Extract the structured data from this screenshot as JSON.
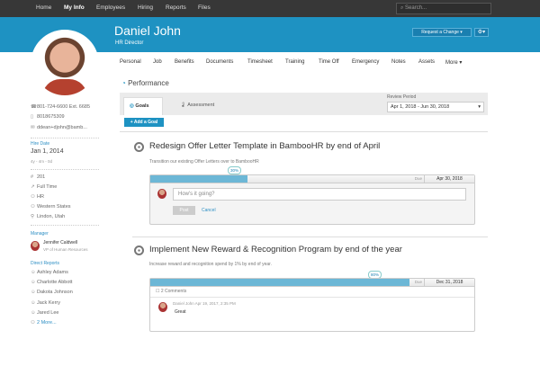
{
  "nav": {
    "items": [
      "Home",
      "My Info",
      "Employees",
      "Hiring",
      "Reports",
      "Files"
    ],
    "search_placeholder": "Search..."
  },
  "header": {
    "name": "Daniel John",
    "title": "HR Director",
    "request_change": "Request a Change ▾",
    "gear": "⚙▾"
  },
  "tabs": [
    "Personal",
    "Job",
    "Benefits",
    "Documents",
    "Timesheet",
    "Training",
    "Time Off",
    "Emergency",
    "Notes",
    "Assets",
    "More ▾"
  ],
  "sidebar": {
    "phone_work": "801-724-6600 Ext. 6685",
    "phone_mobile": "8018675309",
    "email": "ddean+djohn@bamb...",
    "hire_date_label": "Hire Date",
    "hire_date": "Jan 1, 2014",
    "tenure": "4y - 4m - 0d",
    "emp_number": "201",
    "status": "Full Time",
    "department": "HR",
    "division": "Western States",
    "location": "Lindon, Utah",
    "manager_label": "Manager",
    "manager_name": "Jennifer Caldwell",
    "manager_title": "VP of Human Resources",
    "reports_label": "Direct Reports",
    "reports": [
      "Ashley Adams",
      "Charlotte Abbott",
      "Dakota Johnson",
      "Jack Kerry",
      "Jared Lee"
    ],
    "more": "2 More..."
  },
  "performance": {
    "title": "Performance",
    "tab_goals": "Goals",
    "tab_assessment": "Assessment",
    "review_label": "Review Period",
    "review_value": "Apr 1, 2018 - Jun 30, 2018",
    "add_goal": "+ Add a Goal",
    "goals": [
      {
        "title": "Redesign Offer Letter Template in BambooHR by end of April",
        "desc": "Transition our existing Offer Letters over to BambooHR",
        "progress": 30,
        "progress_label": "30%",
        "due_label": "Due",
        "due": "Apr 30, 2018",
        "comment_placeholder": "How's it going?",
        "post": "Post",
        "cancel": "Cancel"
      },
      {
        "title": "Implement New Reward & Recognition Program by end of the year",
        "desc": "Increase reward and recognition spend by 1% by end of year.",
        "progress": 80,
        "progress_label": "80%",
        "due_label": "Due",
        "due": "Dec 31, 2018",
        "comments_count": "2 Comments",
        "comment_meta": "Daniel John Apr 19, 2017, 2:35 PM",
        "comment_text": "Great"
      }
    ]
  }
}
